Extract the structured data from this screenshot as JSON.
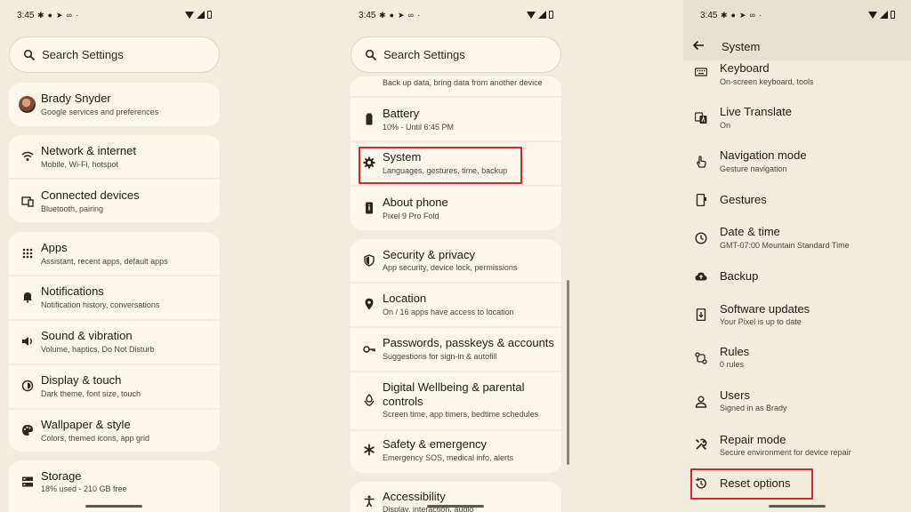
{
  "status": {
    "time": "3:45"
  },
  "screen1": {
    "search_placeholder": "Search Settings",
    "account": {
      "title": "Brady Snyder",
      "subtitle": "Google services and preferences"
    },
    "items": [
      {
        "title": "Network & internet",
        "subtitle": "Mobile, Wi-Fi, hotspot",
        "icon": "wifi-icon"
      },
      {
        "title": "Connected devices",
        "subtitle": "Bluetooth, pairing",
        "icon": "devices-icon"
      },
      {
        "title": "Apps",
        "subtitle": "Assistant, recent apps, default apps",
        "icon": "apps-grid-icon"
      },
      {
        "title": "Notifications",
        "subtitle": "Notification history, conversations",
        "icon": "bell-icon"
      },
      {
        "title": "Sound & vibration",
        "subtitle": "Volume, haptics, Do Not Disturb",
        "icon": "speaker-icon"
      },
      {
        "title": "Display & touch",
        "subtitle": "Dark theme, font size, touch",
        "icon": "brightness-icon"
      },
      {
        "title": "Wallpaper & style",
        "subtitle": "Colors, themed icons, app grid",
        "icon": "palette-icon"
      },
      {
        "title": "Storage",
        "subtitle": "18% used - 210 GB free",
        "icon": "storage-icon"
      }
    ]
  },
  "screen2": {
    "search_placeholder": "Search Settings",
    "clipped_subtitle": "Back up data, bring data from another device",
    "items": [
      {
        "title": "Battery",
        "subtitle": "10% - Until 6:45 PM",
        "icon": "battery-icon"
      },
      {
        "title": "System",
        "subtitle": "Languages, gestures, time, backup",
        "icon": "gear-icon"
      },
      {
        "title": "About phone",
        "subtitle": "Pixel 9 Pro Fold",
        "icon": "phone-info-icon"
      },
      {
        "title": "Security & privacy",
        "subtitle": "App security, device lock, permissions",
        "icon": "shield-icon"
      },
      {
        "title": "Location",
        "subtitle": "On / 16 apps have access to location",
        "icon": "location-pin-icon"
      },
      {
        "title": "Passwords, passkeys & accounts",
        "subtitle": "Suggestions for sign-in & autofill",
        "icon": "key-icon"
      },
      {
        "title": "Digital Wellbeing & parental controls",
        "title_line1": "Digital Wellbeing & parental",
        "title_line2": "controls",
        "subtitle": "Screen time, app timers, bedtime schedules",
        "icon": "wellbeing-icon"
      },
      {
        "title": "Safety & emergency",
        "subtitle": "Emergency SOS, medical info, alerts",
        "icon": "asterisk-icon"
      },
      {
        "title": "Accessibility",
        "subtitle": "Display, interaction, audio",
        "icon": "accessibility-icon"
      }
    ]
  },
  "screen3": {
    "title": "System",
    "items": [
      {
        "title": "Keyboard",
        "subtitle": "On-screen keyboard, tools",
        "icon": "keyboard-icon"
      },
      {
        "title": "Live Translate",
        "subtitle": "On",
        "icon": "translate-icon"
      },
      {
        "title": "Navigation mode",
        "subtitle": "Gesture navigation",
        "icon": "gesture-hand-icon"
      },
      {
        "title": "Gestures",
        "subtitle": "",
        "icon": "gestures-phone-icon"
      },
      {
        "title": "Date & time",
        "subtitle": "GMT-07:00 Mountain Standard Time",
        "icon": "clock-icon"
      },
      {
        "title": "Backup",
        "subtitle": "",
        "icon": "cloud-upload-icon"
      },
      {
        "title": "Software updates",
        "subtitle": "Your Pixel is up to date",
        "icon": "system-update-icon"
      },
      {
        "title": "Rules",
        "subtitle": "0 rules",
        "icon": "rules-icon"
      },
      {
        "title": "Users",
        "subtitle": "Signed in as Brady",
        "icon": "user-icon"
      },
      {
        "title": "Repair mode",
        "subtitle": "Secure environment for device repair",
        "icon": "tools-icon"
      },
      {
        "title": "Reset options",
        "subtitle": "",
        "icon": "history-icon"
      }
    ]
  },
  "colors": {
    "highlight": "#d8262f",
    "card": "#fbf7ea",
    "background": "#f1ecdd"
  }
}
